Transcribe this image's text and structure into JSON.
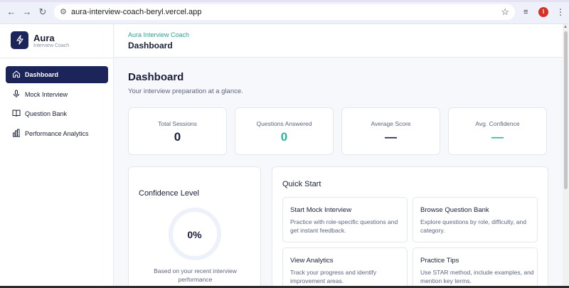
{
  "browser": {
    "url": "aura-interview-coach-beryl.vercel.app",
    "profile_initial": "I",
    "icons": {
      "back": "arrow-left-icon",
      "forward": "arrow-right-icon",
      "reload": "reload-icon",
      "site_info": "site-settings-icon",
      "bookmark": "star-icon",
      "media": "media-queue-icon",
      "menu": "kebab-menu-icon"
    }
  },
  "sidebar": {
    "brand": "Aura",
    "brand_sub": "Interview Coach",
    "logo_icon": "lightning-icon",
    "items": [
      {
        "label": "Dashboard",
        "icon": "home-icon",
        "active": true
      },
      {
        "label": "Mock Interview",
        "icon": "microphone-icon",
        "active": false
      },
      {
        "label": "Question Bank",
        "icon": "book-icon",
        "active": false
      },
      {
        "label": "Performance Analytics",
        "icon": "bar-chart-icon",
        "active": false
      }
    ]
  },
  "header": {
    "crumb": "Aura Interview Coach",
    "title": "Dashboard"
  },
  "main": {
    "title": "Dashboard",
    "subtitle": "Your interview preparation at a glance.",
    "stats": [
      {
        "label": "Total Sessions",
        "value": "0"
      },
      {
        "label": "Questions Answered",
        "value": "0"
      },
      {
        "label": "Average Score",
        "value": "—"
      },
      {
        "label": "Avg. Confidence",
        "value": "—"
      }
    ],
    "confidence": {
      "title": "Confidence Level",
      "value": "0%",
      "note": "Based on your recent interview performance"
    },
    "quick_start": {
      "title": "Quick Start",
      "items": [
        {
          "title": "Start Mock Interview",
          "desc": "Practice with role-specific questions and get instant feedback."
        },
        {
          "title": "Browse Question Bank",
          "desc": "Explore questions by role, difficulty, and category."
        },
        {
          "title": "View Analytics",
          "desc": "Track your progress and identify improvement areas."
        },
        {
          "title": "Practice Tips",
          "desc": "Use STAR method, include examples, and mention key terms."
        }
      ]
    }
  },
  "colors": {
    "navy": "#1b2559",
    "teal": "#2ab3a0",
    "crumb_teal": "#2aa198",
    "avatar_red": "#d93025"
  }
}
